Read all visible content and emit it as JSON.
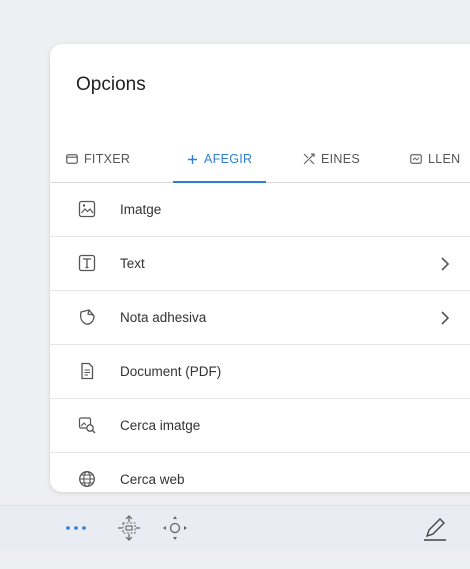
{
  "panel": {
    "title": "Opcions"
  },
  "tabs": [
    {
      "label": "FITXER",
      "icon": "file-icon",
      "active": false
    },
    {
      "label": "AFEGIR",
      "icon": "plus-icon",
      "active": true
    },
    {
      "label": "EINES",
      "icon": "tools-icon",
      "active": false
    },
    {
      "label": "LLEN",
      "icon": "slideshow-icon",
      "active": false
    }
  ],
  "items": [
    {
      "label": "Imatge",
      "icon": "image-icon",
      "chevron": false
    },
    {
      "label": "Text",
      "icon": "text-box-icon",
      "chevron": true
    },
    {
      "label": "Nota adhesiva",
      "icon": "sticky-note-icon",
      "chevron": true
    },
    {
      "label": "Document (PDF)",
      "icon": "document-icon",
      "chevron": false
    },
    {
      "label": "Cerca imatge",
      "icon": "image-search-icon",
      "chevron": false
    },
    {
      "label": "Cerca web",
      "icon": "globe-icon",
      "chevron": false
    }
  ],
  "toolbar": {
    "items": [
      "more-dots-icon",
      "select-move-icon",
      "pan-icon",
      "pen-icon"
    ]
  },
  "colors": {
    "accent": "#2f7fd6",
    "background": "#eeeff1",
    "panel": "#ffffff",
    "toolbar": "#e9ecf2"
  }
}
